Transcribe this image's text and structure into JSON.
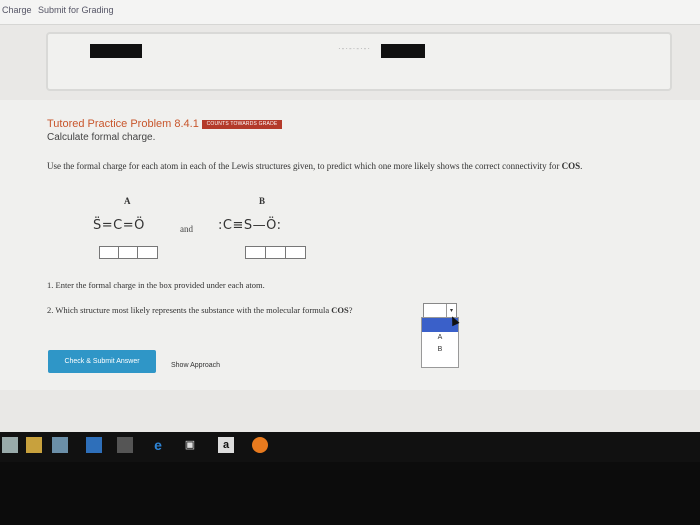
{
  "topbar": {
    "tab1": "Charge",
    "tab2": "Submit for Grading"
  },
  "problem": {
    "title": "Tutored Practice Problem 8.4.1",
    "badge": "COUNTS TOWARDS GRADE",
    "subtitle": "Calculate formal charge.",
    "instructions_pre": "Use the formal charge for each atom in each of the Lewis structures given, to predict which one more likely shows the correct connectivity for ",
    "instructions_formula": "COS",
    "instructions_post": "."
  },
  "structures": {
    "label_a": "A",
    "label_b": "B",
    "lewis_a": "S̈=C=Ö",
    "lewis_b": ":C≡S—Ö:",
    "connector": "and"
  },
  "steps": {
    "step1": "1. Enter the formal charge in the box provided under each atom.",
    "step2_pre": "2. Which structure most likely represents the substance with the molecular formula ",
    "step2_formula": "COS",
    "step2_post": "?"
  },
  "dropdown": {
    "options": [
      "A",
      "B"
    ]
  },
  "actions": {
    "check_submit": "Check & Submit Answer",
    "show_approach": "Show Approach"
  },
  "taskbar": {
    "icons": [
      "file-explorer-icon",
      "calendar-icon",
      "photos-icon",
      "calculator-icon",
      "edge-icon",
      "store-icon",
      "amazon-icon",
      "firefox-icon"
    ]
  },
  "taskbar_labels": {
    "amazon": "a"
  }
}
